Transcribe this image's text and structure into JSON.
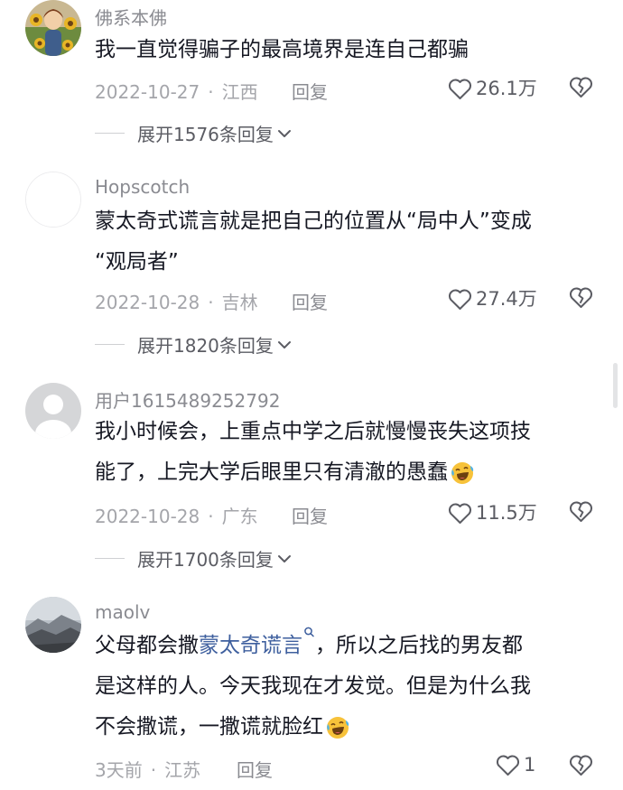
{
  "comments": [
    {
      "username": "佛系本佛",
      "lines": [
        "我一直觉得骗子的最高境界是连自己都骗"
      ],
      "date": "2022-10-27",
      "separator": "·",
      "location": "江西",
      "reply_label": "回复",
      "likes": "26.1万",
      "expand_label": "展开1576条回复",
      "avatar_icon": "sunflower-girl-avatar"
    },
    {
      "username": "Hopscotch",
      "lines": [
        "蒙太奇式谎言就是把自己的位置从“局中人”变成",
        "“观局者”"
      ],
      "date": "2022-10-28",
      "separator": "·",
      "location": "吉林",
      "reply_label": "回复",
      "likes": "27.4万",
      "expand_label": "展开1820条回复",
      "avatar_icon": "blank-avatar"
    },
    {
      "username": "用户1615489252792",
      "lines": [
        "我小时候会，上重点中学之后就慢慢丧失这项技",
        "能了，上完大学后眼里只有清澈的愚蠢"
      ],
      "date": "2022-10-28",
      "separator": "·",
      "location": "广东",
      "reply_label": "回复",
      "likes": "11.5万",
      "expand_label": "展开1700条回复",
      "avatar_icon": "default-user-avatar",
      "emoji_icon": "laughing-crying-emoji"
    },
    {
      "username": "maolv",
      "line1_before": "父母都会撒",
      "line1_link": "蒙太奇谎言",
      "line1_after": "，所以之后找的男友都",
      "lines_rest": [
        "是这样的人。今天我现在才发觉。但是为什么我",
        "不会撒谎，一撒谎就脸红"
      ],
      "date": "3天前",
      "separator": "·",
      "location": "江苏",
      "reply_label": "回复",
      "likes": "1",
      "avatar_icon": "mountain-landscape-avatar",
      "emoji_icon": "laughing-crying-emoji"
    }
  ],
  "colors": {
    "text": "#161823",
    "secondary": "#8a8b91",
    "meta": "#a4a5aa",
    "link": "#3e5f9e"
  }
}
